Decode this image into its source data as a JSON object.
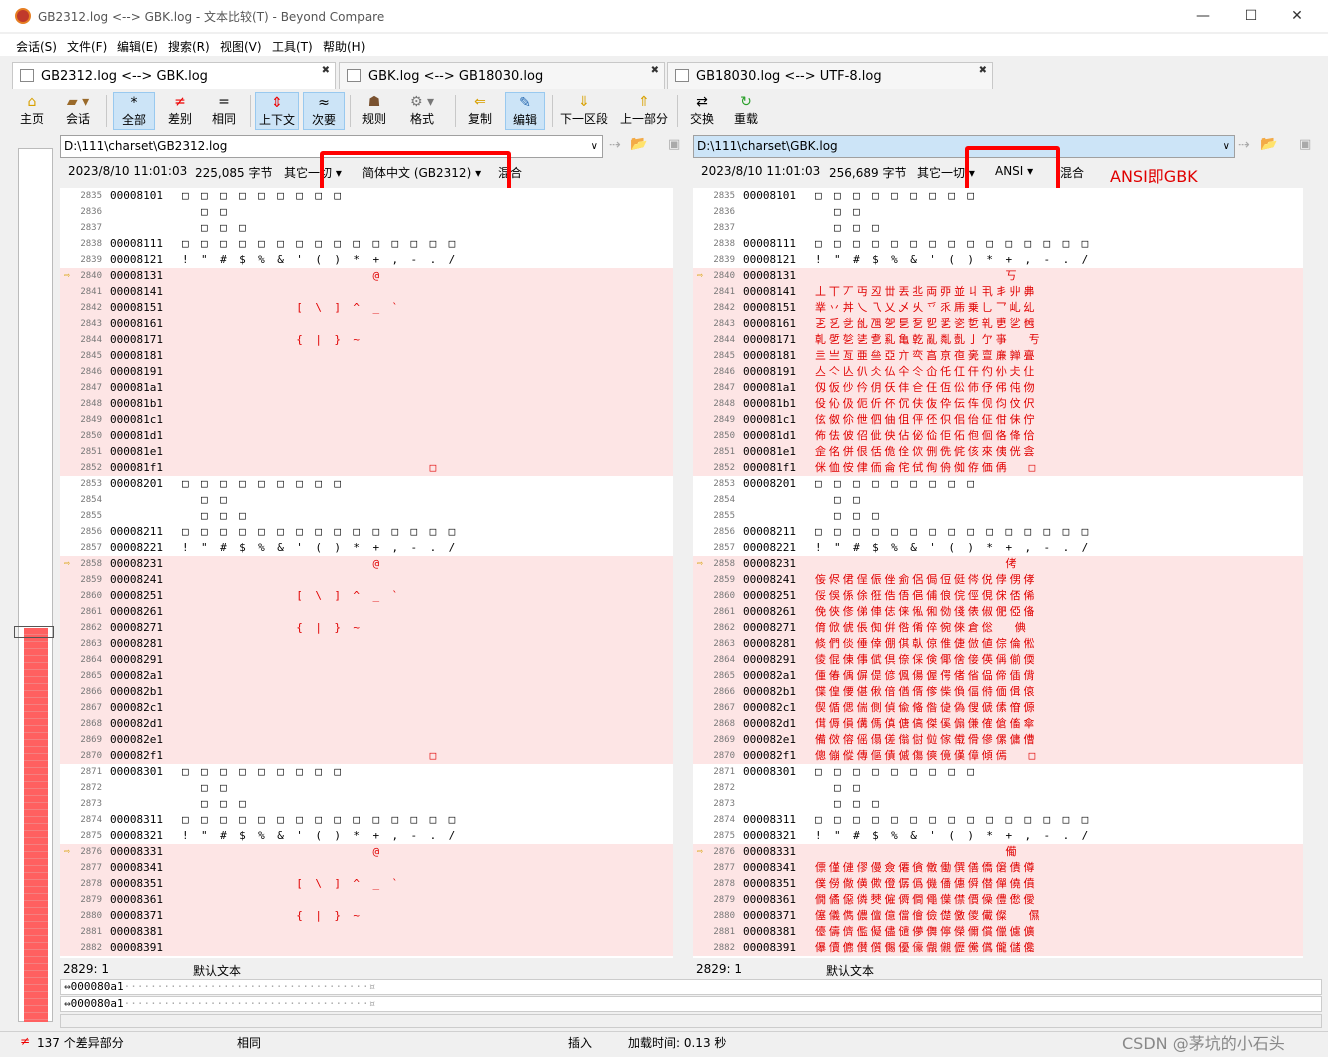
{
  "window": {
    "title": "GB2312.log <--> GBK.log - 文本比较(T) - Beyond Compare"
  },
  "menu": [
    "会话(S)",
    "文件(F)",
    "编辑(E)",
    "搜索(R)",
    "视图(V)",
    "工具(T)",
    "帮助(H)"
  ],
  "tabs": [
    {
      "label": "GB2312.log <--> GBK.log",
      "active": true
    },
    {
      "label": "GBK.log <--> GB18030.log",
      "active": false
    },
    {
      "label": "GB18030.log <--> UTF-8.log",
      "active": false
    }
  ],
  "toolbar": [
    {
      "label": "主页",
      "icon": "home-icon"
    },
    {
      "label": "会话",
      "icon": "briefcase-icon"
    },
    {
      "label": "全部",
      "icon": "asterisk-icon"
    },
    {
      "label": "差别",
      "icon": "not-equal-icon"
    },
    {
      "label": "相同",
      "icon": "equal-icon"
    },
    {
      "label": "上下文",
      "icon": "context-icon"
    },
    {
      "label": "次要",
      "icon": "approx-icon"
    },
    {
      "label": "规则",
      "icon": "person-icon"
    },
    {
      "label": "格式",
      "icon": "gear-icon"
    },
    {
      "label": "复制",
      "icon": "copy-arrow-icon"
    },
    {
      "label": "编辑",
      "icon": "edit-icon"
    },
    {
      "label": "下一区段",
      "icon": "down-arrow-icon"
    },
    {
      "label": "上一部分",
      "icon": "up-arrow-icon"
    },
    {
      "label": "交换",
      "icon": "swap-icon"
    },
    {
      "label": "重载",
      "icon": "reload-icon"
    }
  ],
  "left": {
    "path": "D:\\111\\charset\\GB2312.log",
    "date": "2023/8/10 11:01:03",
    "size": "225,085 字节",
    "other": "其它一切",
    "encoding": "简体中文 (GB2312)",
    "mode": "混合",
    "status_pos": "2829: 1",
    "status_fmt": "默认文本"
  },
  "right": {
    "path": "D:\\111\\charset\\GBK.log",
    "date": "2023/8/10 11:01:03",
    "size": "256,689 字节",
    "other": "其它一切",
    "encoding": "ANSI",
    "mode": "混合",
    "status_pos": "2829: 1",
    "status_fmt": "默认文本"
  },
  "annotation": "ANSI即GBK",
  "left_rows": [
    {
      "n": "2835",
      "a": "00008101",
      "t": "□ □ □ □ □ □ □ □ □",
      "d": false
    },
    {
      "n": "2836",
      "a": "",
      "t": "  □ □",
      "d": false
    },
    {
      "n": "2837",
      "a": "",
      "t": "  □ □ □",
      "d": false
    },
    {
      "n": "2838",
      "a": "00008111",
      "t": "□ □ □ □ □ □ □ □ □ □ □ □ □ □ □",
      "d": false
    },
    {
      "n": "2839",
      "a": "00008121",
      "t": "! \" # $ % & ' ( ) * + , - . /",
      "d": false
    },
    {
      "n": "2840",
      "a": "00008131",
      "t": "                    @",
      "d": true,
      "m": true
    },
    {
      "n": "2841",
      "a": "00008141",
      "t": "",
      "d": true
    },
    {
      "n": "2842",
      "a": "00008151",
      "t": "            [ \\ ] ^ _ `",
      "d": true
    },
    {
      "n": "2843",
      "a": "00008161",
      "t": "",
      "d": true
    },
    {
      "n": "2844",
      "a": "00008171",
      "t": "            { | } ~",
      "d": true
    },
    {
      "n": "2845",
      "a": "00008181",
      "t": "",
      "d": true
    },
    {
      "n": "2846",
      "a": "00008191",
      "t": "",
      "d": true
    },
    {
      "n": "2847",
      "a": "000081a1",
      "t": "",
      "d": true
    },
    {
      "n": "2848",
      "a": "000081b1",
      "t": "",
      "d": true
    },
    {
      "n": "2849",
      "a": "000081c1",
      "t": "",
      "d": true
    },
    {
      "n": "2850",
      "a": "000081d1",
      "t": "",
      "d": true
    },
    {
      "n": "2851",
      "a": "000081e1",
      "t": "",
      "d": true
    },
    {
      "n": "2852",
      "a": "000081f1",
      "t": "                          □",
      "d": true
    },
    {
      "n": "2853",
      "a": "00008201",
      "t": "□ □ □ □ □ □ □ □ □",
      "d": false
    },
    {
      "n": "2854",
      "a": "",
      "t": "  □ □",
      "d": false
    },
    {
      "n": "2855",
      "a": "",
      "t": "  □ □ □",
      "d": false
    },
    {
      "n": "2856",
      "a": "00008211",
      "t": "□ □ □ □ □ □ □ □ □ □ □ □ □ □ □",
      "d": false
    },
    {
      "n": "2857",
      "a": "00008221",
      "t": "! \" # $ % & ' ( ) * + , - . /",
      "d": false
    },
    {
      "n": "2858",
      "a": "00008231",
      "t": "                    @",
      "d": true,
      "m": true
    },
    {
      "n": "2859",
      "a": "00008241",
      "t": "",
      "d": true
    },
    {
      "n": "2860",
      "a": "00008251",
      "t": "            [ \\ ] ^ _ `",
      "d": true
    },
    {
      "n": "2861",
      "a": "00008261",
      "t": "",
      "d": true
    },
    {
      "n": "2862",
      "a": "00008271",
      "t": "            { | } ~",
      "d": true
    },
    {
      "n": "2863",
      "a": "00008281",
      "t": "",
      "d": true
    },
    {
      "n": "2864",
      "a": "00008291",
      "t": "",
      "d": true
    },
    {
      "n": "2865",
      "a": "000082a1",
      "t": "",
      "d": true
    },
    {
      "n": "2866",
      "a": "000082b1",
      "t": "",
      "d": true
    },
    {
      "n": "2867",
      "a": "000082c1",
      "t": "",
      "d": true
    },
    {
      "n": "2868",
      "a": "000082d1",
      "t": "",
      "d": true
    },
    {
      "n": "2869",
      "a": "000082e1",
      "t": "",
      "d": true
    },
    {
      "n": "2870",
      "a": "000082f1",
      "t": "                          □",
      "d": true
    },
    {
      "n": "2871",
      "a": "00008301",
      "t": "□ □ □ □ □ □ □ □ □",
      "d": false
    },
    {
      "n": "2872",
      "a": "",
      "t": "  □ □",
      "d": false
    },
    {
      "n": "2873",
      "a": "",
      "t": "  □ □ □",
      "d": false
    },
    {
      "n": "2874",
      "a": "00008311",
      "t": "□ □ □ □ □ □ □ □ □ □ □ □ □ □ □",
      "d": false
    },
    {
      "n": "2875",
      "a": "00008321",
      "t": "! \" # $ % & ' ( ) * + , - . /",
      "d": false
    },
    {
      "n": "2876",
      "a": "00008331",
      "t": "                    @",
      "d": true,
      "m": true
    },
    {
      "n": "2877",
      "a": "00008341",
      "t": "",
      "d": true
    },
    {
      "n": "2878",
      "a": "00008351",
      "t": "            [ \\ ] ^ _ `",
      "d": true
    },
    {
      "n": "2879",
      "a": "00008361",
      "t": "",
      "d": true
    },
    {
      "n": "2880",
      "a": "00008371",
      "t": "            { | } ~",
      "d": true
    },
    {
      "n": "2881",
      "a": "00008381",
      "t": "",
      "d": true
    },
    {
      "n": "2882",
      "a": "00008391",
      "t": "",
      "d": true
    }
  ],
  "right_rows": [
    {
      "n": "2835",
      "a": "00008101",
      "t": "□ □ □ □ □ □ □ □ □",
      "d": false
    },
    {
      "n": "2836",
      "a": "",
      "t": "  □ □",
      "d": false
    },
    {
      "n": "2837",
      "a": "",
      "t": "  □ □ □",
      "d": false
    },
    {
      "n": "2838",
      "a": "00008111",
      "t": "□ □ □ □ □ □ □ □ □ □ □ □ □ □ □",
      "d": false
    },
    {
      "n": "2839",
      "a": "00008121",
      "t": "! \" # $ % & ' ( ) * + , - . /",
      "d": false
    },
    {
      "n": "2840",
      "a": "00008131",
      "t": "                    丂",
      "d": true,
      "m": true
    },
    {
      "n": "2841",
      "a": "00008141",
      "t": "丄丅丆丏丒丗丟丠両丣並丩丮丯丱丳",
      "d": true
    },
    {
      "n": "2842",
      "a": "00008151",
      "t": "丵丷丼乀乁乂乄乆乊乑乕乗乚乛乢乣",
      "d": true
    },
    {
      "n": "2843",
      "a": "00008161",
      "t": "乤乥乧乨乪乫乬乭乮乯乲乴乵乶乷乸",
      "d": true
    },
    {
      "n": "2844",
      "a": "00008171",
      "t": "乹乺乻乼乽乿亀亁亂亃亄亅亇亊  亐",
      "d": true
    },
    {
      "n": "2845",
      "a": "00008181",
      "t": "亖亗亙亜亝亞亣亪亯亰亱亴亶亷亸亹",
      "d": true
    },
    {
      "n": "2846",
      "a": "00008191",
      "t": "亼亽亾仈仌仏仐仒仚仛仜仠仢仦仧仩",
      "d": true
    },
    {
      "n": "2847",
      "a": "000081a1",
      "t": "仭仮仯仱仴仸仹仺仼仾伀伂伃伄伅伆",
      "d": true
    },
    {
      "n": "2848",
      "a": "000081b1",
      "t": "伇伈伋伌伒伓伔伕伖伜伝伡伣伨伩伬",
      "d": true
    },
    {
      "n": "2849",
      "a": "000081c1",
      "t": "伭伮伱伳伵伷伹伻伾伿佀佁佂佄佅佇",
      "d": true
    },
    {
      "n": "2850",
      "a": "000081d1",
      "t": "佈佉佊佋佌佒佔佖佡佢佦佨佪佫佭佮",
      "d": true
    },
    {
      "n": "2851",
      "a": "000081e1",
      "t": "佱佲併佷佸佹佺佽侀侁侂侅來侇侊侌",
      "d": true
    },
    {
      "n": "2852",
      "a": "000081f1",
      "t": "侎侐侒侓侕侖侘侙侚侜侞侟価侢  □",
      "d": true
    },
    {
      "n": "2853",
      "a": "00008201",
      "t": "□ □ □ □ □ □ □ □ □",
      "d": false
    },
    {
      "n": "2854",
      "a": "",
      "t": "  □ □",
      "d": false
    },
    {
      "n": "2855",
      "a": "",
      "t": "  □ □ □",
      "d": false
    },
    {
      "n": "2856",
      "a": "00008211",
      "t": "□ □ □ □ □ □ □ □ □ □ □ □ □ □ □",
      "d": false
    },
    {
      "n": "2857",
      "a": "00008221",
      "t": "! \" # $ % & ' ( ) * + , - . /",
      "d": false
    },
    {
      "n": "2858",
      "a": "00008231",
      "t": "                    侤",
      "d": true,
      "m": true
    },
    {
      "n": "2859",
      "a": "00008241",
      "t": "侫侭侰侱侲侳侴侶侷侸侹侺侻侼侽侾",
      "d": true
    },
    {
      "n": "2860",
      "a": "00008251",
      "t": "俀俁係俆俇俈俉俋俌俍俒俓俔俕俖俙",
      "d": true
    },
    {
      "n": "2861",
      "a": "00008261",
      "t": "俛俠俢俤俥俧俫俬俰俲俴俵俶俷俹俻",
      "d": true
    },
    {
      "n": "2862",
      "a": "00008271",
      "t": "俼俽俿倀倁倂倃倄倅倇倈倉倊  倎",
      "d": true
    },
    {
      "n": "2863",
      "a": "00008281",
      "t": "倐們倓倕倖倗倛倝倞倠倢倣値倧倫倯",
      "d": true
    },
    {
      "n": "2864",
      "a": "00008291",
      "t": "倰倱倲倳倵倶倷倸倹倻倽倿偀偁偂偄",
      "d": true
    },
    {
      "n": "2865",
      "a": "000082a1",
      "t": "偅偆偊偋偍偐偑偒偓偔偖偗偘偙偛偝",
      "d": true
    },
    {
      "n": "2866",
      "a": "000082b1",
      "t": "偞偟偠偡偢偣偤偦偧偨偩偪偫偭偮偯",
      "d": true
    },
    {
      "n": "2867",
      "a": "000082c1",
      "t": "偰偱偲偳側偵偸偹偺偼偽傁傂傃傄傆",
      "d": true
    },
    {
      "n": "2868",
      "a": "000082d1",
      "t": "傇傉傊傋傌傎傏傐傑傒傓傔傕傖傗傘",
      "d": true
    },
    {
      "n": "2869",
      "a": "000082e1",
      "t": "備傚傛傜傝傞傟傠傡傢傤傦傪傫傭傮",
      "d": true
    },
    {
      "n": "2870",
      "a": "000082f1",
      "t": "傯傰傱傳傴債傶傷傸傹傼傽傾傿  □",
      "d": true
    },
    {
      "n": "2871",
      "a": "00008301",
      "t": "□ □ □ □ □ □ □ □ □",
      "d": false
    },
    {
      "n": "2872",
      "a": "",
      "t": "  □ □",
      "d": false
    },
    {
      "n": "2873",
      "a": "",
      "t": "  □ □ □",
      "d": false
    },
    {
      "n": "2874",
      "a": "00008311",
      "t": "□ □ □ □ □ □ □ □ □ □ □ □ □ □ □",
      "d": false
    },
    {
      "n": "2875",
      "a": "00008321",
      "t": "! \" # $ % & ' ( ) * + , - . /",
      "d": false
    },
    {
      "n": "2876",
      "a": "00008331",
      "t": "                    僃",
      "d": true,
      "m": true
    },
    {
      "n": "2877",
      "a": "00008341",
      "t": "僄僅僆僇僈僉僊僋僌働僎僐僑僒僓僔",
      "d": true
    },
    {
      "n": "2878",
      "a": "00008351",
      "t": "僕僗僘僙僛僜僝僞僟僠僡僢僣僤僥僨",
      "d": true
    },
    {
      "n": "2879",
      "a": "00008361",
      "t": "僩僪僫僯僰僱僲僴僶僷僸價僺僼僽僾",
      "d": true
    },
    {
      "n": "2880",
      "a": "00008371",
      "t": "僿儀儁儂儃億儅儈儉儊儌儍儎儏  儑",
      "d": true
    },
    {
      "n": "2881",
      "a": "00008381",
      "t": "儓儔儕儖儗儘儙儚儛儜儝儞償儠儢儣",
      "d": true
    },
    {
      "n": "2882",
      "a": "00008391",
      "t": "儤儥儦儧儨儩優儫儬儭儮儯儰儱儲儳",
      "d": true
    }
  ],
  "bottom_lines": [
    "000080a1",
    "000080a1"
  ],
  "status": {
    "diff_count": "137 个差异部分",
    "same": "相同",
    "insert": "插入",
    "load_time": "加载时间: 0.13 秒"
  },
  "watermark": "CSDN @茅坑的小石头"
}
